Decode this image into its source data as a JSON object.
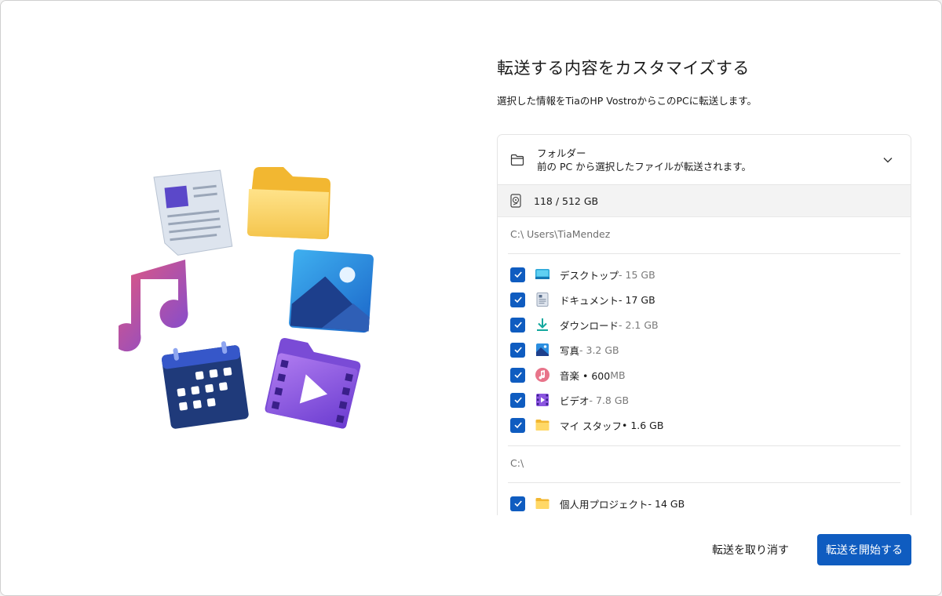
{
  "header": {
    "title": "転送する内容をカスタマイズする",
    "subtitle": "選択した情報をTiaのHP VostroからこのPCに転送します。"
  },
  "panel": {
    "folder_label": "フォルダー",
    "folder_desc": "前の PC から選択したファイルが転送されます。",
    "storage": "118 / 512 GB",
    "sections": [
      {
        "path": "C:\\ Users\\TiaMendez",
        "items": [
          {
            "name": "デスクトップ",
            "size": "- 15 GB",
            "icon": "desktop-icon",
            "checked": true
          },
          {
            "name": "ドキュメント",
            "size": " - 17 GB",
            "icon": "documents-icon",
            "checked": true
          },
          {
            "name": "ダウンロード",
            "size": "   - 2.1 GB",
            "icon": "download-icon",
            "checked": true
          },
          {
            "name": "写真",
            "size": "       - 3.2 GB",
            "icon": "pictures-icon",
            "checked": true
          },
          {
            "name": "音楽 • 600",
            "size": "    MB",
            "icon": "music-icon",
            "checked": true
          },
          {
            "name": "ビデオ",
            "size": "  - 7.8 GB",
            "icon": "video-icon",
            "checked": true
          },
          {
            "name": "マイ スタッフ",
            "size": " • 1.6 GB",
            "icon": "folder-icon",
            "checked": true
          }
        ]
      },
      {
        "path": "C:\\",
        "items": [
          {
            "name": "個人用プロジェクト",
            "size": " - 14 GB",
            "icon": "folder-icon",
            "checked": true
          }
        ]
      }
    ]
  },
  "footer": {
    "cancel_label": "転送を取り消す",
    "start_label": "転送を開始する"
  },
  "colors": {
    "accent": "#0f5cc0",
    "muted": "#6e6e6e"
  }
}
